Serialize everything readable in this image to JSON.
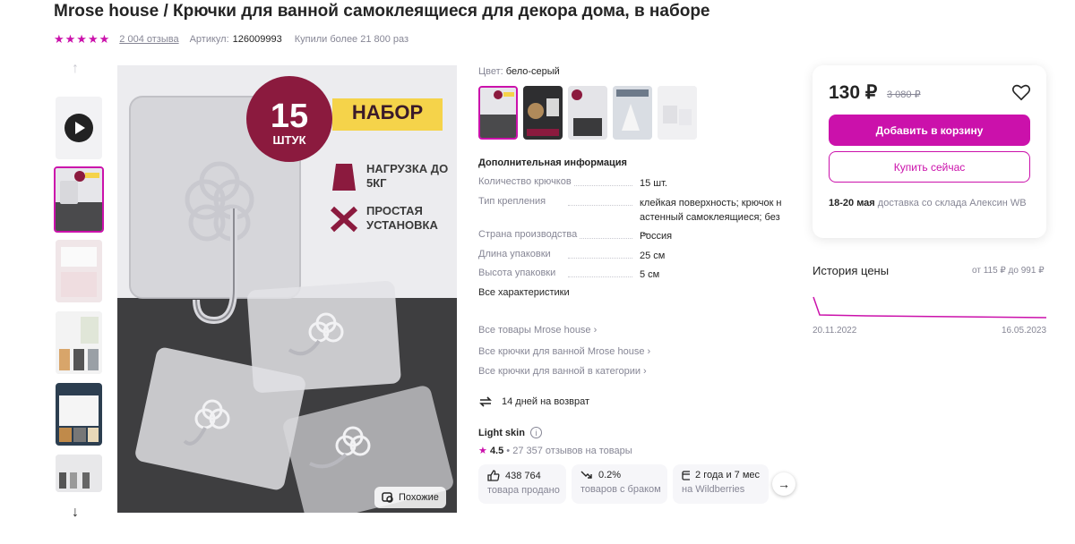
{
  "header": {
    "title": "Mrose house / Крючки для ванной самоклеящиеся для декора дома, в наборе",
    "stars": "★★★★★",
    "reviews": "2 004 отзыва",
    "sku_label": "Артикул:",
    "sku_value": "126009993",
    "bought": "Купили более 21 800 раз"
  },
  "gallery": {
    "up_arrow": "↑",
    "down_arrow": "↓",
    "image_badge_number": "15",
    "image_badge_unit": "ШТУК",
    "image_tag": "НАБОР",
    "image_feature_1": "НАГРУЗКА ДО 5КГ",
    "image_feature_2": "ПРОСТАЯ УСТАНОВКА",
    "similar_button": "Похожие"
  },
  "product": {
    "color_label": "Цвет:",
    "color_value": "бело-серый",
    "add_info_title": "Дополнительная информация",
    "specs": [
      {
        "key": "Количество крючков",
        "value": "15 шт."
      },
      {
        "key": "Тип крепления",
        "value": "клейкая поверхность; крючок н астенный самоклеящиеся; без ..."
      },
      {
        "key": "Страна производства",
        "value": "Россия"
      },
      {
        "key": "Длина упаковки",
        "value": "25 см"
      },
      {
        "key": "Высота упаковки",
        "value": "5 см"
      }
    ],
    "all_specs": "Все характеристики",
    "links": [
      "Все товары Mrose house ›",
      "Все крючки для ванной Mrose house ›",
      "Все крючки для ванной в категории ›"
    ],
    "return_text": "14 дней на возврат",
    "skin_name": "Light skin",
    "brand_rating_value": "4.5",
    "brand_rating_text": "• 27 357 отзывов на товары",
    "stats": [
      {
        "top": "438 764",
        "bottom": "товара продано",
        "icon": "thumbs-up-icon"
      },
      {
        "top": "0.2%",
        "bottom": "товаров с браком",
        "icon": "trend-down-icon"
      },
      {
        "top": "2 года и 7 мес",
        "bottom": "на Wildberries",
        "icon": "calendar-icon"
      }
    ],
    "stats_next": "→"
  },
  "buy_card": {
    "price": "130 ₽",
    "old_price": "3 080 ₽",
    "add_to_cart": "Добавить в корзину",
    "buy_now": "Купить сейчас",
    "delivery_date": "18-20 мая",
    "delivery_text": "доставка со склада Алексин WB"
  },
  "price_history": {
    "title": "История цены",
    "range": "от 115 ₽ до 991 ₽",
    "date_start": "20.11.2022",
    "date_end": "16.05.2023"
  },
  "colors": {
    "accent": "#cb11ab",
    "text": "#242424",
    "muted": "#868695"
  }
}
